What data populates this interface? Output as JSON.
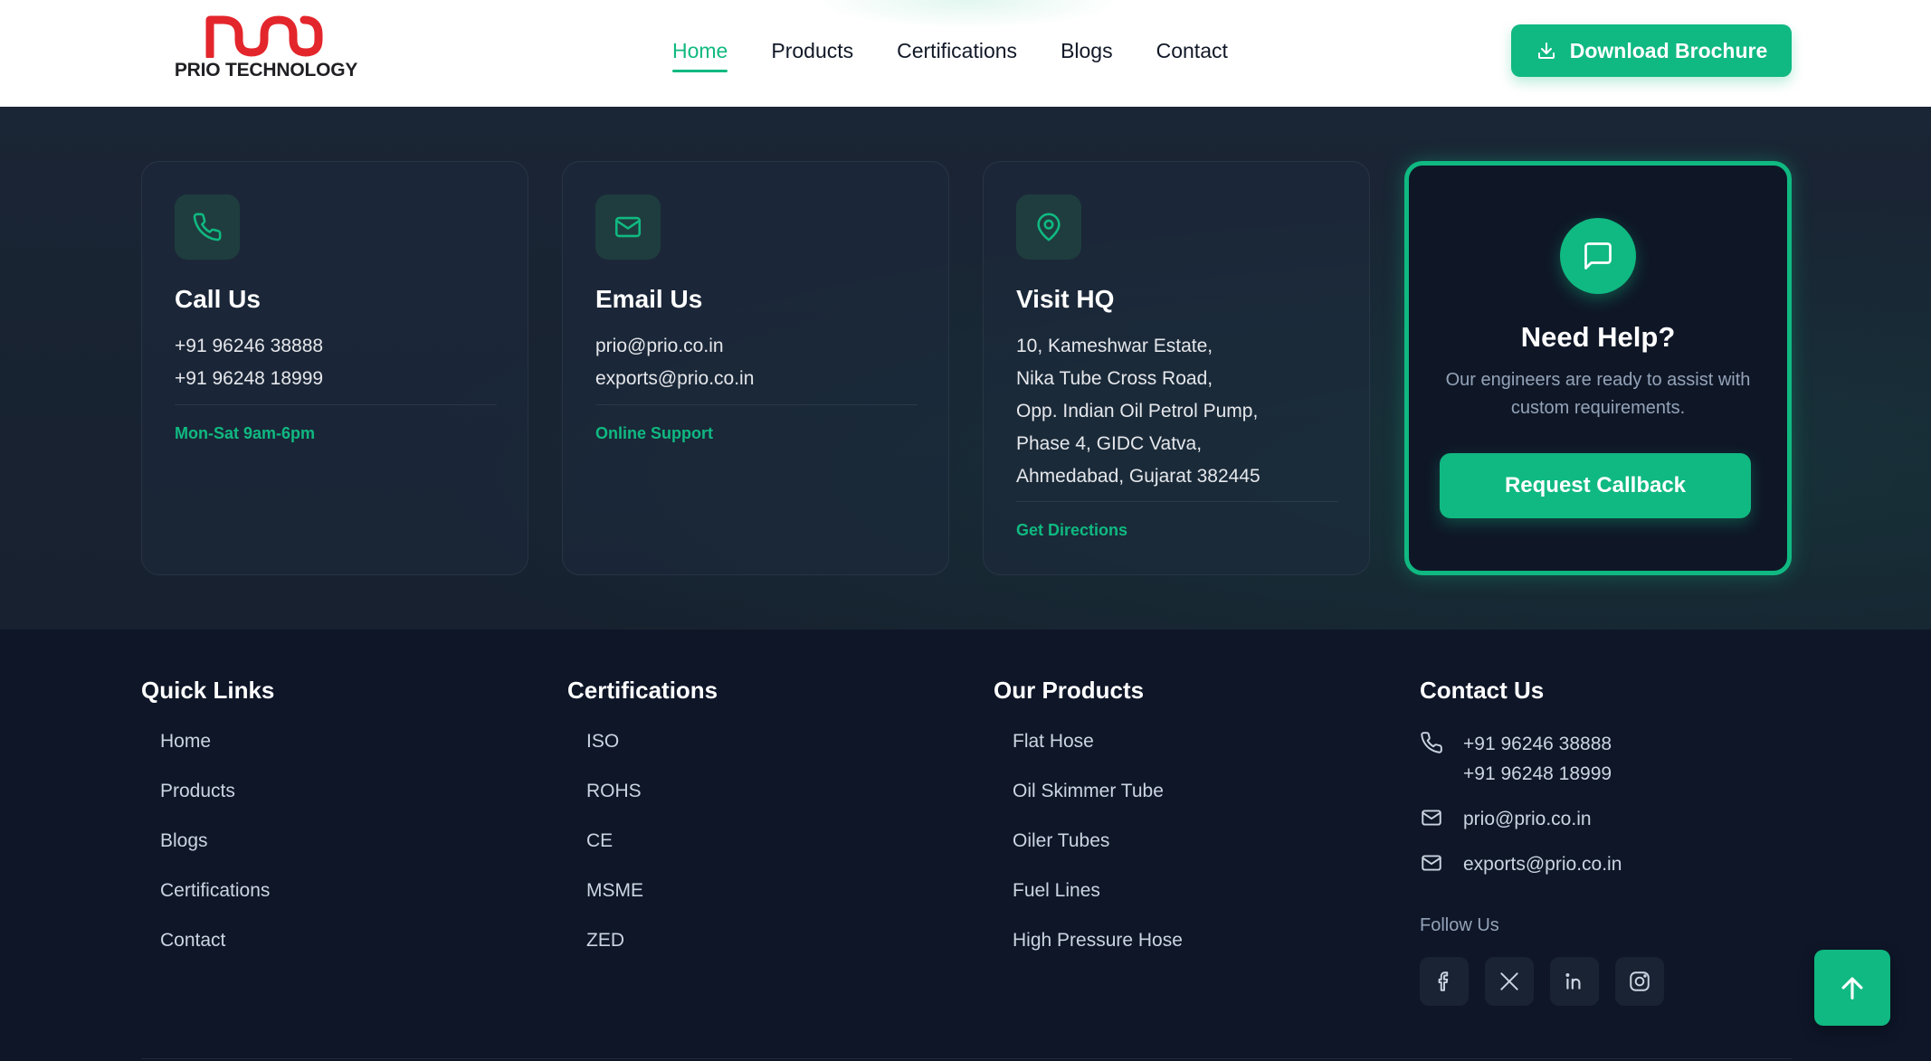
{
  "brand": {
    "name": "PRIO TECHNOLOGY",
    "logo_color": "#e3262c",
    "accent": "#10b981"
  },
  "nav": {
    "links": [
      {
        "label": "Home",
        "active": true
      },
      {
        "label": "Products",
        "active": false
      },
      {
        "label": "Certifications",
        "active": false
      },
      {
        "label": "Blogs",
        "active": false
      },
      {
        "label": "Contact",
        "active": false
      }
    ],
    "brochure_label": "Download Brochure",
    "brochure_icon": "download-icon"
  },
  "contact_cards": [
    {
      "icon": "phone-icon",
      "title": "Call Us",
      "lines": [
        "+91 96246 38888",
        "+91 96248 18999"
      ],
      "footer": "Mon-Sat 9am-6pm"
    },
    {
      "icon": "mail-icon",
      "title": "Email Us",
      "lines": [
        "prio@prio.co.in",
        "exports@prio.co.in"
      ],
      "footer": "Online Support"
    },
    {
      "icon": "map-pin-icon",
      "title": "Visit HQ",
      "lines": [
        "10, Kameshwar Estate,",
        "Nika Tube Cross Road,",
        "Opp. Indian Oil Petrol Pump,",
        "Phase 4, GIDC Vatva,",
        "Ahmedabad, Gujarat 382445"
      ],
      "footer": "Get Directions"
    }
  ],
  "help_card": {
    "icon": "chat-icon",
    "title": "Need Help?",
    "description": "Our engineers are ready to assist with custom requirements.",
    "button_label": "Request Callback"
  },
  "footer": {
    "quick_links": {
      "title": "Quick Links",
      "items": [
        "Home",
        "Products",
        "Blogs",
        "Certifications",
        "Contact"
      ]
    },
    "certifications": {
      "title": "Certifications",
      "items": [
        "ISO",
        "ROHS",
        "CE",
        "MSME",
        "ZED"
      ]
    },
    "products": {
      "title": "Our Products",
      "items": [
        "Flat Hose",
        "Oil Skimmer Tube",
        "Oiler Tubes",
        "Fuel Lines",
        "High Pressure Hose"
      ]
    },
    "contact": {
      "title": "Contact Us",
      "phone_1": "+91 96246 38888",
      "phone_2": "+91 96248 18999",
      "email_1": "prio@prio.co.in",
      "email_2": "exports@prio.co.in",
      "follow_label": "Follow Us",
      "socials": [
        "facebook-icon",
        "x-icon",
        "linkedin-icon",
        "instagram-icon"
      ]
    }
  }
}
